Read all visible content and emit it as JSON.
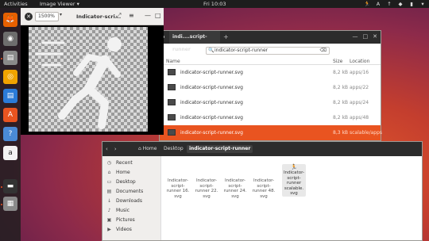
{
  "topbar": {
    "activities": "Activities",
    "app_menu": "Image Viewer ▾",
    "clock": "Fri 10:03",
    "tray": [
      "🏃",
      "A",
      "↑",
      "◆",
      "▮",
      "▾"
    ]
  },
  "dock": {
    "items": [
      "🦊",
      "◉",
      "▤",
      "◎",
      "▤",
      "A",
      "?",
      "a",
      "▬",
      "▦"
    ]
  },
  "image_viewer": {
    "close": "✕",
    "zoom": "1500%",
    "zoom_caret": "▾",
    "title": "Indicator-scri...",
    "fullscreen": "⤢",
    "menu": "≡",
    "minimize": "—",
    "maximize": "□"
  },
  "file_chooser": {
    "back": "◂",
    "tab_title": "indi....script-runner",
    "tab_plus": "+",
    "win_buttons": [
      "—",
      "□",
      "✕"
    ],
    "search_value": "indicator-script-runner",
    "search_icon": "🔍",
    "search_clear": "⌫",
    "columns": {
      "name": "Name",
      "size": "Size",
      "location": "Location"
    },
    "rows": [
      {
        "name": "indicator-script-runner.svg",
        "size": "8,2 kB",
        "location": "apps/16"
      },
      {
        "name": "indicator-script-runner.svg",
        "size": "8,2 kB",
        "location": "apps/22"
      },
      {
        "name": "indicator-script-runner.svg",
        "size": "8,2 kB",
        "location": "apps/24"
      },
      {
        "name": "indicator-script-runner.svg",
        "size": "8,2 kB",
        "location": "apps/48"
      },
      {
        "name": "indicator-script-runner.svg",
        "size": "8,3 kB",
        "location": "scalable/apps"
      }
    ]
  },
  "files": {
    "nav": [
      "‹",
      "›"
    ],
    "breadcrumbs": {
      "home": "Home",
      "desktop": "Desktop",
      "current": "indicator-script-runner"
    },
    "sidebar": [
      {
        "icon": "◷",
        "label": "Recent"
      },
      {
        "icon": "⌂",
        "label": "Home"
      },
      {
        "icon": "▭",
        "label": "Desktop"
      },
      {
        "icon": "▤",
        "label": "Documents"
      },
      {
        "icon": "↓",
        "label": "Downloads"
      },
      {
        "icon": "♪",
        "label": "Music"
      },
      {
        "icon": "▣",
        "label": "Pictures"
      },
      {
        "icon": "▶",
        "label": "Videos"
      }
    ],
    "tiles": [
      {
        "lines": [
          "Indicator-",
          "script-",
          "runner 16.",
          "svg"
        ]
      },
      {
        "lines": [
          "Indicator-",
          "script-",
          "runner 22.",
          "svg"
        ]
      },
      {
        "lines": [
          "Indicator-",
          "script-",
          "runner 24.",
          "svg"
        ]
      },
      {
        "lines": [
          "Indicator-",
          "script-",
          "runner 48.",
          "svg"
        ]
      },
      {
        "lines": [
          "Indicator-",
          "script-",
          "runner",
          "scalable.",
          "svg"
        ],
        "runner_icon": "🏃"
      }
    ]
  },
  "colors": {
    "accent": "#e95420",
    "topbar": "#1d1d1d"
  }
}
